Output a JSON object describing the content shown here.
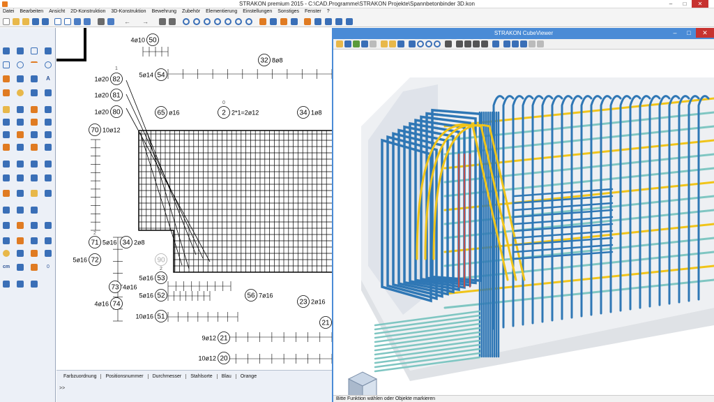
{
  "window": {
    "title": "STRAKON premium 2015  - C:\\CAD.Programme\\STRAKON Projekte\\Spannbetonbinder 3D.kon",
    "minimize": "–",
    "maximize": "□",
    "close": "✕"
  },
  "menu": [
    "Datei",
    "Bearbeiten",
    "Ansicht",
    "2D-Konstruktion",
    "3D-Konstruktion",
    "Bewehrung",
    "Zubehör",
    "Elementierung",
    "Einstellungen",
    "Sonstiges",
    "Fenster",
    "?"
  ],
  "palette": {
    "text_tool": "A",
    "unit_label": "cm",
    "counter_value": "0"
  },
  "drawing": {
    "labels": [
      {
        "num": "50",
        "text": "4ø10"
      },
      {
        "num": "54",
        "text": "5ø14"
      },
      {
        "num": "32",
        "text": "8ø8"
      },
      {
        "num": "82",
        "text": "1ø20"
      },
      {
        "num": "81",
        "text": "1ø20"
      },
      {
        "num": "80",
        "text": "1ø20"
      },
      {
        "num": "65",
        "text": "ø16"
      },
      {
        "num": "2",
        "text": "2*1=2ø12"
      },
      {
        "num": "34",
        "text": "1ø8"
      },
      {
        "num": "70",
        "text": "10ø12"
      },
      {
        "num": "71",
        "text": "5ø16"
      },
      {
        "num": "34",
        "text": "2ø8"
      },
      {
        "num": "72",
        "text": "5ø16"
      },
      {
        "num": "90",
        "text": ""
      },
      {
        "num": "73",
        "text": "4ø16"
      },
      {
        "num": "53",
        "text": "5ø16"
      },
      {
        "num": "52",
        "text": "5ø16"
      },
      {
        "num": "56",
        "text": "7ø16"
      },
      {
        "num": "74",
        "text": "4ø16"
      },
      {
        "num": "23",
        "text": "2ø16"
      },
      {
        "num": "51",
        "text": "10ø16"
      },
      {
        "num": "21",
        "text": ""
      },
      {
        "num": "21",
        "text": "9ø12"
      },
      {
        "num": "20",
        "text": "10ø12"
      }
    ],
    "small_marks": [
      "1",
      "0",
      "2",
      "2"
    ]
  },
  "options_bar": {
    "items": [
      "Farbzuordnung",
      "Positionsnummer",
      "Durchmesser",
      "Stahlsorte",
      "Blau",
      "Orange"
    ],
    "more": ">>"
  },
  "cubeviewer": {
    "title": "STRAKON CubeViewer",
    "status": "Bitte Funktion wählen oder Objekte markieren"
  },
  "colors": {
    "accent": "#4a8bd6",
    "rebar_blue": "#2f77b5",
    "rebar_yellow": "#f0c419",
    "rebar_red": "#c0504d",
    "rebar_cyan": "#7fc6c2",
    "palette_bg": "#ecf0f7"
  }
}
